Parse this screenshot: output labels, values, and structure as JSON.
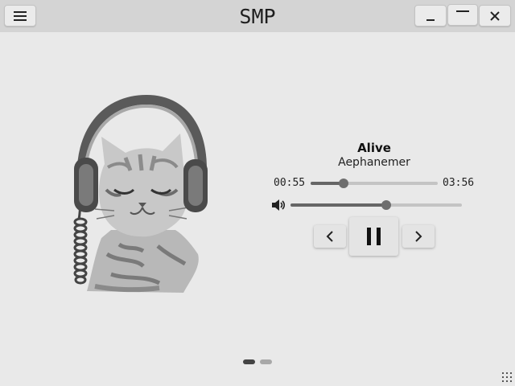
{
  "window": {
    "title": "SMP",
    "menu_icon": "hamburger-menu-icon",
    "minimize_icon": "minimize-icon",
    "maximize_icon": "maximize-icon",
    "close_icon": "close-icon"
  },
  "album_art": {
    "icon": "cat-with-headphones-illustration"
  },
  "track": {
    "title": "Alive",
    "artist": "Aephanemer",
    "elapsed": "00:55",
    "duration": "03:56",
    "progress_fraction": 0.26
  },
  "volume": {
    "icon": "speaker-icon",
    "level_fraction": 0.56
  },
  "controls": {
    "previous_icon": "chevron-left-icon",
    "pause_icon": "pause-icon",
    "next_icon": "chevron-right-icon"
  },
  "pager": {
    "pages": 2,
    "active_index": 0
  },
  "resize_grip_icon": "resize-grip-icon",
  "colors": {
    "background": "#e9e9e9",
    "titlebar": "#d4d4d4",
    "accent": "#666666"
  }
}
